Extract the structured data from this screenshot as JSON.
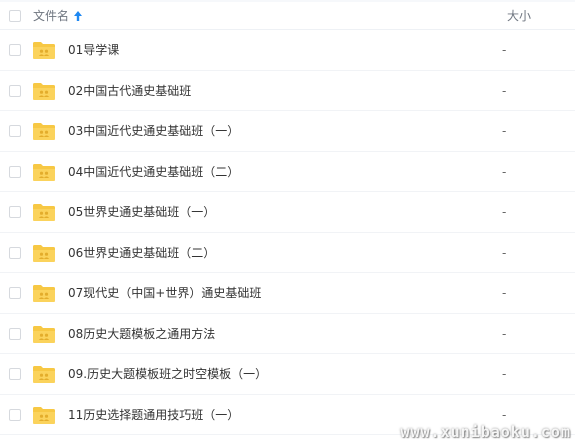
{
  "header": {
    "name_label": "文件名",
    "size_label": "大小",
    "sort_icon": "sort-ascending-arrow",
    "accent_color": "#1e88f2"
  },
  "files": [
    {
      "name": "01导学课",
      "size": "-"
    },
    {
      "name": "02中国古代通史基础班",
      "size": "-"
    },
    {
      "name": "03中国近代史通史基础班（一）",
      "size": "-"
    },
    {
      "name": "04中国近代史通史基础班（二）",
      "size": "-"
    },
    {
      "name": "05世界史通史基础班（一）",
      "size": "-"
    },
    {
      "name": "06世界史通史基础班（二）",
      "size": "-"
    },
    {
      "name": "07现代史（中国+世界）通史基础班",
      "size": "-"
    },
    {
      "name": "08历史大题模板之通用方法",
      "size": "-"
    },
    {
      "name": "09.历史大题模板班之时空模板（一）",
      "size": "-"
    },
    {
      "name": "11历史选择题通用技巧班（一）",
      "size": "-"
    }
  ],
  "folder_icon": "folder-icon",
  "folder_color": "#f7c844",
  "watermark": "www.xunibaoku.com"
}
